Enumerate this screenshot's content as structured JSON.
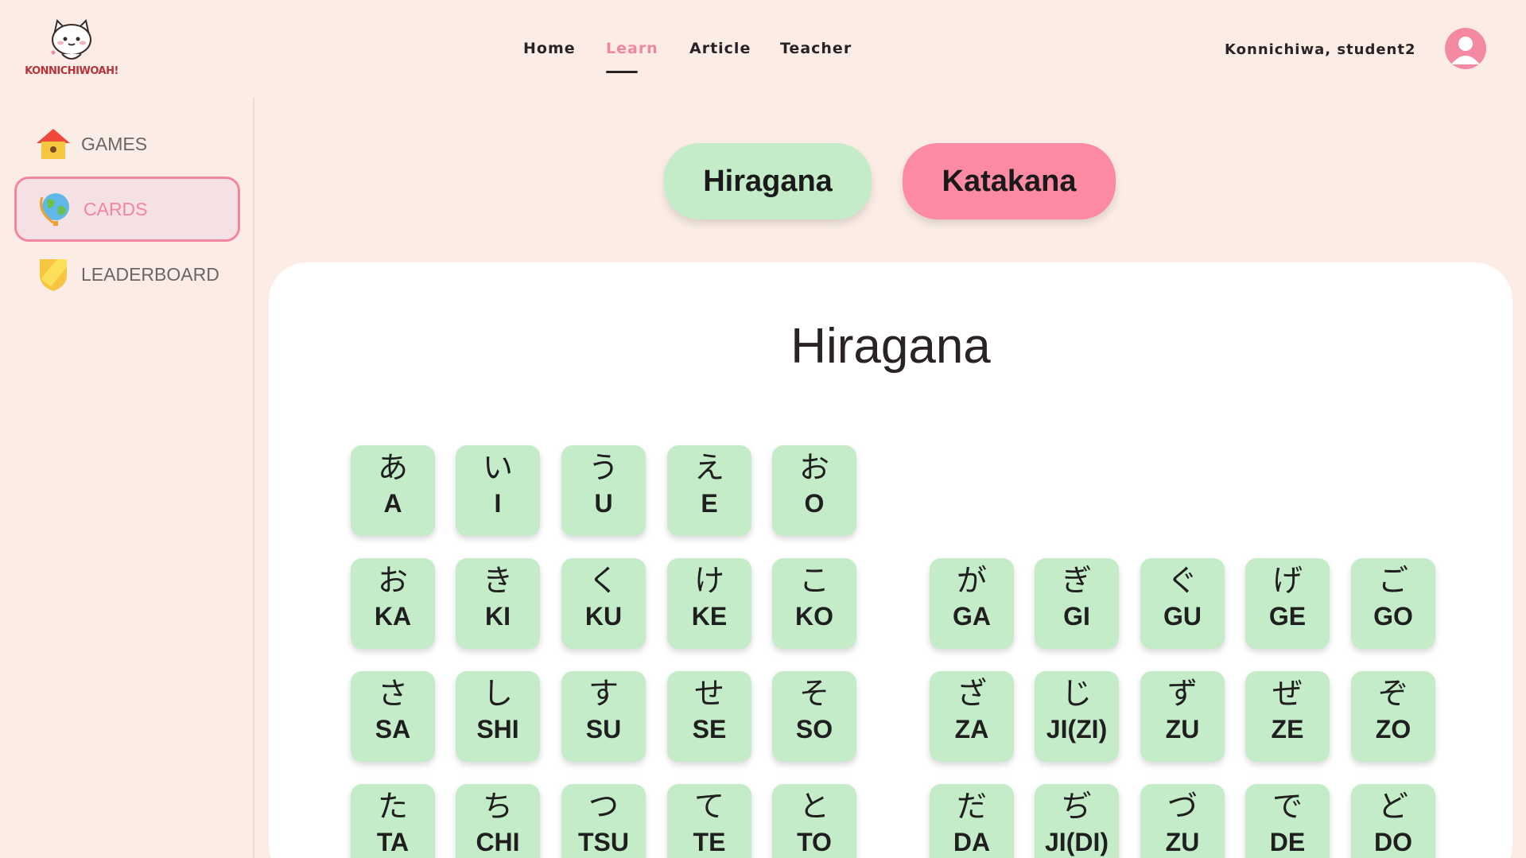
{
  "logo": {
    "text": "KONNICHIWOAH!"
  },
  "nav": {
    "items": [
      {
        "label": "Home"
      },
      {
        "label": "Learn",
        "active": true
      },
      {
        "label": "Article"
      },
      {
        "label": "Teacher"
      }
    ],
    "greeting": "Konnichiwa, student2"
  },
  "sidebar": {
    "items": [
      {
        "label": "GAMES",
        "icon": "house-icon"
      },
      {
        "label": "CARDS",
        "icon": "globe-icon",
        "active": true
      },
      {
        "label": "LEADERBOARD",
        "icon": "shield-icon"
      }
    ]
  },
  "toggle": {
    "hiragana": "Hiragana",
    "katakana": "Katakana"
  },
  "panel": {
    "title": "Hiragana"
  },
  "colors": {
    "background": "#fbede6",
    "accent_pink": "#f286a0",
    "card_green": "#c5ecc9",
    "katakana_button": "#fb8aa2"
  },
  "cards": {
    "row0_left": [
      {
        "kana": "あ",
        "romaji": "A"
      },
      {
        "kana": "い",
        "romaji": "I"
      },
      {
        "kana": "う",
        "romaji": "U"
      },
      {
        "kana": "え",
        "romaji": "E"
      },
      {
        "kana": "お",
        "romaji": "O"
      }
    ],
    "row1_left": [
      {
        "kana": "お",
        "romaji": "KA"
      },
      {
        "kana": "き",
        "romaji": "KI"
      },
      {
        "kana": "く",
        "romaji": "KU"
      },
      {
        "kana": "け",
        "romaji": "KE"
      },
      {
        "kana": "こ",
        "romaji": "KO"
      }
    ],
    "row1_right": [
      {
        "kana": "が",
        "romaji": "GA"
      },
      {
        "kana": "ぎ",
        "romaji": "GI"
      },
      {
        "kana": "ぐ",
        "romaji": "GU"
      },
      {
        "kana": "げ",
        "romaji": "GE"
      },
      {
        "kana": "ご",
        "romaji": "GO"
      }
    ],
    "row2_left": [
      {
        "kana": "さ",
        "romaji": "SA"
      },
      {
        "kana": "し",
        "romaji": "SHI"
      },
      {
        "kana": "す",
        "romaji": "SU"
      },
      {
        "kana": "せ",
        "romaji": "SE"
      },
      {
        "kana": "そ",
        "romaji": "SO"
      }
    ],
    "row2_right": [
      {
        "kana": "ざ",
        "romaji": "ZA"
      },
      {
        "kana": "じ",
        "romaji": "JI(ZI)"
      },
      {
        "kana": "ず",
        "romaji": "ZU"
      },
      {
        "kana": "ぜ",
        "romaji": "ZE"
      },
      {
        "kana": "ぞ",
        "romaji": "ZO"
      }
    ],
    "row3_left": [
      {
        "kana": "た",
        "romaji": "TA"
      },
      {
        "kana": "ち",
        "romaji": "CHI"
      },
      {
        "kana": "つ",
        "romaji": "TSU"
      },
      {
        "kana": "て",
        "romaji": "TE"
      },
      {
        "kana": "と",
        "romaji": "TO"
      }
    ],
    "row3_right": [
      {
        "kana": "だ",
        "romaji": "DA"
      },
      {
        "kana": "ぢ",
        "romaji": "JI(DI)"
      },
      {
        "kana": "づ",
        "romaji": "ZU"
      },
      {
        "kana": "で",
        "romaji": "DE"
      },
      {
        "kana": "ど",
        "romaji": "DO"
      }
    ]
  }
}
